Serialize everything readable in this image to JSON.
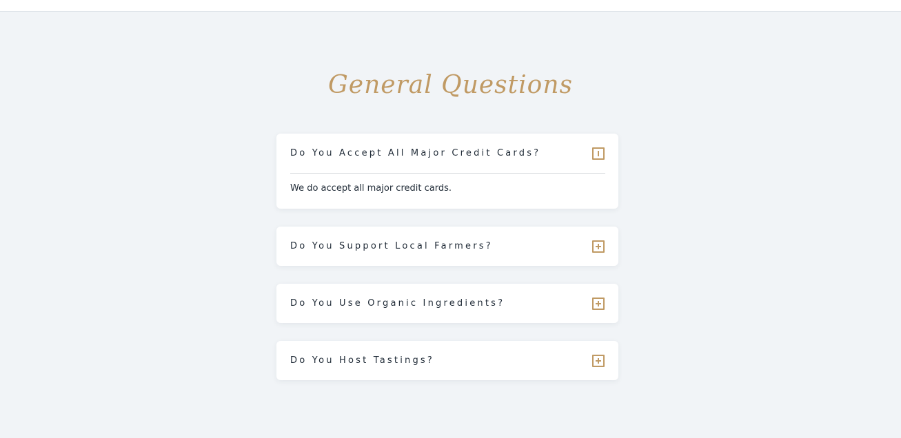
{
  "section_title": "General Questions",
  "faq": [
    {
      "question": "Do You Accept All Major Credit Cards?",
      "answer": "We do accept all major credit cards.",
      "expanded": true,
      "icon": "minus-square-icon"
    },
    {
      "question": "Do You Support Local Farmers?",
      "expanded": false,
      "icon": "plus-square-icon"
    },
    {
      "question": "Do You Use Organic Ingredients?",
      "expanded": false,
      "icon": "plus-square-icon"
    },
    {
      "question": "Do You Host Tastings?",
      "expanded": false,
      "icon": "plus-square-icon"
    }
  ],
  "colors": {
    "accent": "#c09a64",
    "background": "#f1f4f7",
    "card": "#ffffff",
    "text": "#1f2a36"
  }
}
